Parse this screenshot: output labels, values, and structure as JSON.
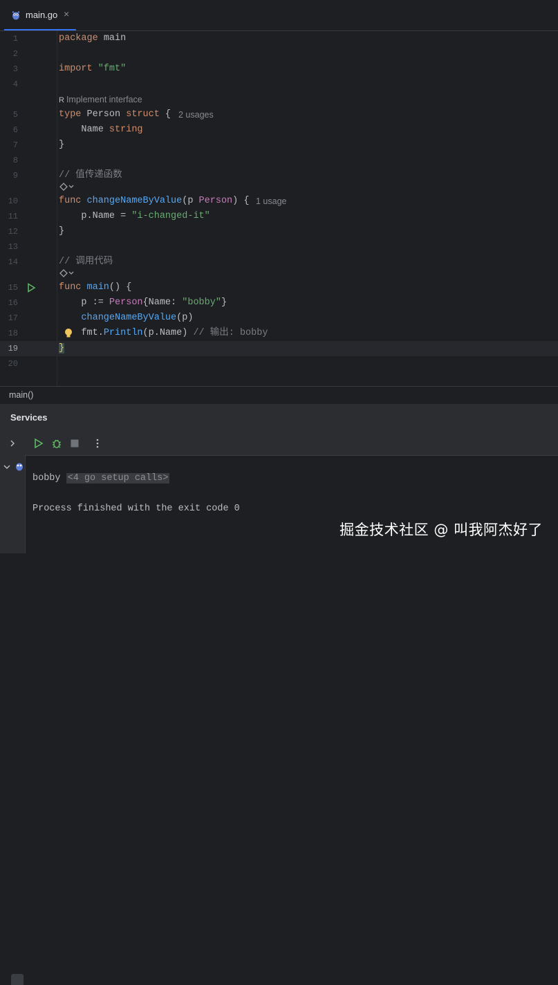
{
  "tab": {
    "label": "main.go",
    "close": "×"
  },
  "code_lines": [
    {
      "n": "1"
    },
    {
      "n": "2"
    },
    {
      "n": "3"
    },
    {
      "n": "4"
    },
    {
      "n": "5"
    },
    {
      "n": "6"
    },
    {
      "n": "7"
    },
    {
      "n": "8"
    },
    {
      "n": "9"
    },
    {
      "n": "10"
    },
    {
      "n": "11"
    },
    {
      "n": "12"
    },
    {
      "n": "13"
    },
    {
      "n": "14"
    },
    {
      "n": "15"
    },
    {
      "n": "16"
    },
    {
      "n": "17"
    },
    {
      "n": "18"
    },
    {
      "n": "19"
    },
    {
      "n": "20"
    }
  ],
  "code": {
    "l1_kw": "package",
    "l1_id": " main",
    "l3_kw": "import",
    "l3_str": " \"fmt\"",
    "l5_kw": "type",
    "l5_id": " Person ",
    "l5_kw2": "struct",
    "l5_br": " {",
    "l6_id": "    Name ",
    "l6_ty": "string",
    "l7_br": "}",
    "l9_cm": "// 值传递函数",
    "l10_kw": "func",
    "l10_fn": " changeNameByValue",
    "l10_p1": "(p ",
    "l10_ty": "Person",
    "l10_p2": ") {",
    "l11_id": "    p.Name = ",
    "l11_str": "\"i-changed-it\"",
    "l12_br": "}",
    "l14_cm": "// 调用代码",
    "l15_kw": "func",
    "l15_fn": " main",
    "l15_p": "() {",
    "l16_id": "    p := ",
    "l16_ty": "Person",
    "l16_p": "{Name: ",
    "l16_str": "\"bobby\"",
    "l16_e": "}",
    "l17_fn": "    changeNameByValue",
    "l17_p": "(p)",
    "l18_id": "    fmt.",
    "l18_fn": "Println",
    "l18_p": "(p.Name) ",
    "l18_cm": "// 输出: bobby",
    "l19_br": "}"
  },
  "hints": {
    "implement": "Implement interface",
    "person_usages": "2 usages",
    "change_usages": "1 usage"
  },
  "statusline": {
    "breadcrumb": "main()"
  },
  "services": {
    "title": "Services",
    "console": {
      "folded": "<4 go setup calls>",
      "out1": "bobby",
      "out2": "Process finished with the exit code 0"
    }
  },
  "watermark": "掘金技术社区 @ 叫我阿杰好了",
  "colors": {
    "accent": "#3574f0",
    "run_green": "#5fb865",
    "bulb": "#f2c55c"
  }
}
